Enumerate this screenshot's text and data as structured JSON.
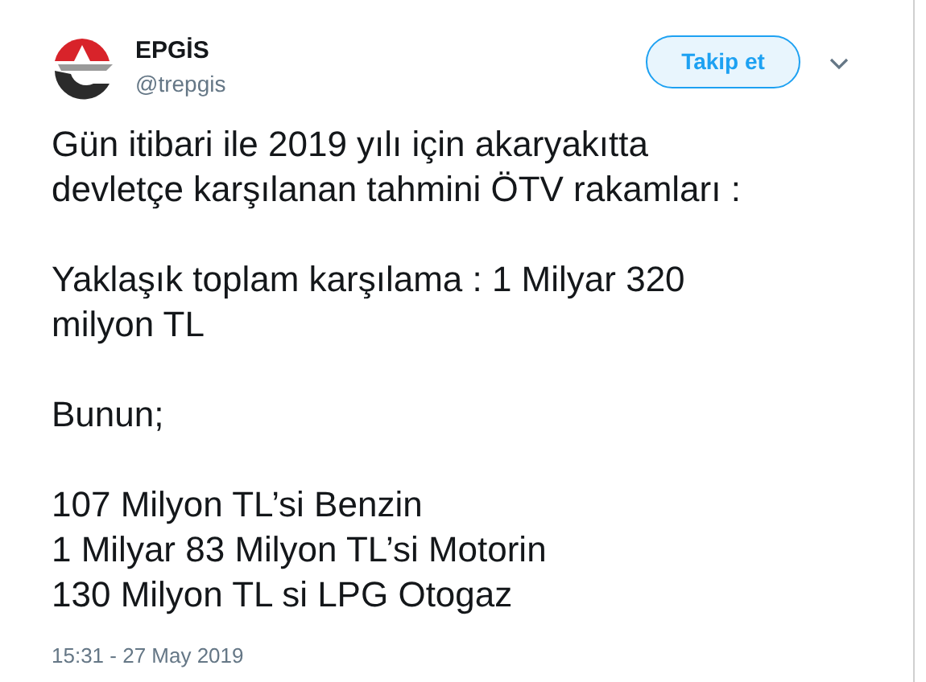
{
  "author": {
    "name": "EPGİS",
    "handle": "@trepgis"
  },
  "follow_button": "Takip et",
  "paragraphs": [
    [
      "Gün itibari ile 2019 yılı için akaryakıtta",
      "devletçe karşılanan tahmini ÖTV rakamları :"
    ],
    [
      "Yaklaşık toplam karşılama : 1 Milyar 320",
      "milyon TL"
    ],
    [
      "Bunun;"
    ],
    [
      "107 Milyon TL’si Benzin",
      "1 Milyar 83 Milyon TL’si Motorin",
      "130 Milyon TL si LPG Otogaz"
    ]
  ],
  "timestamp": "15:31 - 27 May 2019"
}
